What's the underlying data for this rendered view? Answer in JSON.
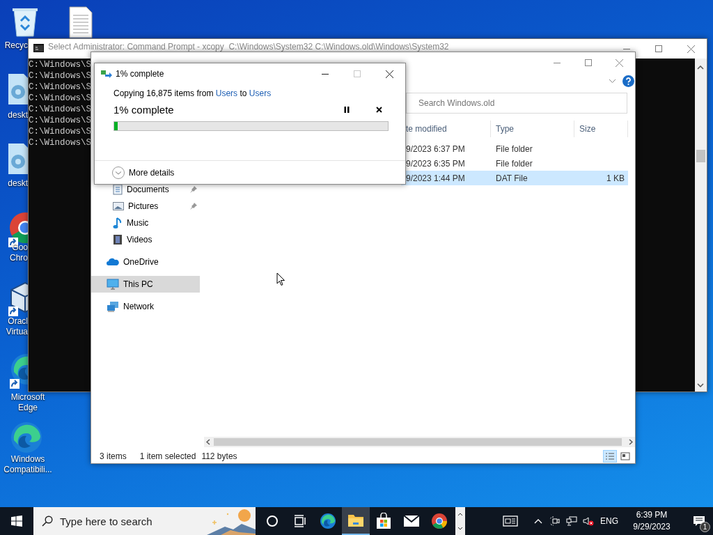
{
  "desktop": {
    "icons": [
      {
        "kind": "recycle-bin",
        "shortcut": false,
        "lines": [
          "Recyc"
        ]
      },
      {
        "kind": "document",
        "shortcut": false
      },
      {
        "kind": "gear-file",
        "shortcut": false,
        "lines": [
          "deskt"
        ]
      },
      {
        "kind": "gear-file",
        "shortcut": false,
        "lines": [
          "deskt"
        ]
      },
      {
        "kind": "chrome",
        "shortcut": true,
        "lines": [
          "Goo",
          "Chro"
        ]
      },
      {
        "kind": "virtualbox",
        "shortcut": true,
        "lines": [
          "Oracl",
          "Virtua"
        ]
      },
      {
        "kind": "edge",
        "shortcut": true,
        "lines": [
          "Microsoft",
          "Edge"
        ]
      },
      {
        "kind": "edge",
        "shortcut": false,
        "lines": [
          "Windows",
          "Compatibili..."
        ]
      }
    ]
  },
  "command_prompt": {
    "title": "Select Administrator: Command Prompt - xcopy  C:\\Windows\\System32 C:\\Windows.old\\Windows\\System32",
    "lines": [
      "C:\\Windows\\S",
      "C:\\Windows\\S",
      "C:\\Windows\\S",
      "C:\\Windows\\S",
      "C:\\Windows\\S",
      "C:\\Windows\\S",
      "C:\\Windows\\S",
      "C:\\Windows\\S"
    ]
  },
  "explorer": {
    "search": {
      "placeholder": "Search Windows.old"
    },
    "columns": [
      "te modified",
      "Type",
      "Size"
    ],
    "rows": [
      {
        "date": "9/2023 6:37 PM",
        "type": "File folder",
        "selected": false
      },
      {
        "date": "9/2023 6:35 PM",
        "type": "File folder",
        "selected": false
      },
      {
        "date": "9/2023 1:44 PM",
        "type": "DAT File",
        "size": "1 KB",
        "selected": true
      }
    ],
    "nav": {
      "quick_access": [
        {
          "label": "Documents",
          "kind": "documents",
          "pinned": true,
          "selected": false
        },
        {
          "label": "Pictures",
          "kind": "pictures",
          "pinned": true,
          "selected": false
        },
        {
          "label": "Music",
          "kind": "music",
          "pinned": false,
          "selected": false
        },
        {
          "label": "Videos",
          "kind": "videos",
          "pinned": false,
          "selected": false
        }
      ],
      "locations": [
        {
          "label": "OneDrive",
          "kind": "onedrive",
          "selected": false
        },
        {
          "label": "This PC",
          "kind": "this-pc",
          "selected": true
        },
        {
          "label": "Network",
          "kind": "network",
          "selected": false
        }
      ]
    },
    "status": {
      "item_count": "3 items",
      "selection": "1 item selected",
      "size": "112 bytes"
    },
    "view_buttons": [
      {
        "kind": "details",
        "selected": true
      },
      {
        "kind": "large-icons",
        "selected": false
      }
    ]
  },
  "copy_dialog": {
    "title": "1% complete",
    "maximize_disabled": true,
    "message": {
      "prefix": "Copying 16,875 items from",
      "source": "Users",
      "middle": "to",
      "destination": "Users"
    },
    "progress_label": "1% complete",
    "level": 0.013,
    "details_label": "More details"
  },
  "taskbar": {
    "search": {
      "placeholder": "Type here to search"
    },
    "apps": [
      {
        "kind": "cortana",
        "active": false
      },
      {
        "kind": "task-view",
        "active": false
      },
      {
        "kind": "edge",
        "active": false
      },
      {
        "kind": "explorer",
        "active": true
      },
      {
        "kind": "store",
        "active": false
      },
      {
        "kind": "mail",
        "active": false
      },
      {
        "kind": "chrome",
        "active": false
      }
    ],
    "tray": {
      "muted": true,
      "language": "ENG",
      "time": "6:39 PM",
      "date": "9/29/2023",
      "notification_count": "1"
    }
  }
}
